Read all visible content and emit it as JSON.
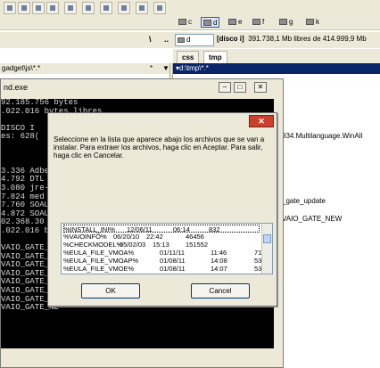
{
  "toolbar": {
    "drives": [
      {
        "letter": "c"
      },
      {
        "letter": "d",
        "selected": true
      },
      {
        "letter": "e"
      },
      {
        "letter": "f"
      },
      {
        "letter": "g"
      },
      {
        "letter": "k"
      }
    ]
  },
  "info_row": {
    "left_sep": "\\",
    "left_up": "..",
    "drive": "d",
    "disk_label": "[disco i]",
    "disk_free": "391.738,1 Mb libres de 414.999,9 Mb"
  },
  "tabs": [
    {
      "label": "css"
    },
    {
      "label": "tmp",
      "active": true
    }
  ],
  "left_panel": {
    "path": "gadget\\js\\*.*",
    "star": "*",
    "up": "▼"
  },
  "right_panel": {
    "path": "▾d:\\tmp\\*.*",
    "items": [
      "934.Multilanguage.WinAll",
      "_gate_update",
      "VAIO_GATE_NEW"
    ]
  },
  "console_window": {
    "title": "nd.exe",
    "min": "–",
    "max": "□",
    "close": "✕",
    "lines": [
      "92.185.756 bytes",
      ".022.016 bytes libres",
      "",
      "DISCO I",
      "es: 628(",
      "",
      "",
      "",
      "3.336 Adbe",
      "4.792 DTL",
      "3.080 jre-",
      "7.824 med",
      "7.760 SOAU",
      "4.872 SOAU",
      "02.368.30",
      ".022.016 b",
      "",
      "VAIO_GATE_NE",
      "VAIO_GATE_NE",
      "VAIO_GATE_NE",
      "VAIO_GATE_NE",
      "VAIO_GATE_NE",
      "VAIO_GATE_NE",
      "VAIO_GATE_NE",
      "VAIO_GATE_NE"
    ]
  },
  "dialog": {
    "close": "✕",
    "message": "Seleccione en la lista que aparece abajo los archivos que se van a instalar. Para extraer los archivos, haga clic en Aceptar. Para salir, haga clic en Cancelar.",
    "files": [
      {
        "name": "%INSTALL_INI%",
        "date": "12/06/11",
        "time": "06:14",
        "size": "832"
      },
      {
        "name": "%VAIOINFO%",
        "date": "06/20/10",
        "time": "22:42",
        "size": "46456"
      },
      {
        "name": "%CHECKMODEL%",
        "date": "05/02/03",
        "time": "15:13",
        "size": "151552"
      },
      {
        "name": "%EULA_FILE_VMOA%",
        "date": "01/11/11",
        "time": "11:46",
        "size": "71"
      },
      {
        "name": "%EULA_FILE_VMOAP%",
        "date": "01/08/11",
        "time": "14:08",
        "size": "53"
      },
      {
        "name": "%EULA_FILE_VMOE%",
        "date": "01/08/11",
        "time": "14:07",
        "size": "53"
      }
    ],
    "ok_label": "OK",
    "cancel_label": "Cancel"
  }
}
